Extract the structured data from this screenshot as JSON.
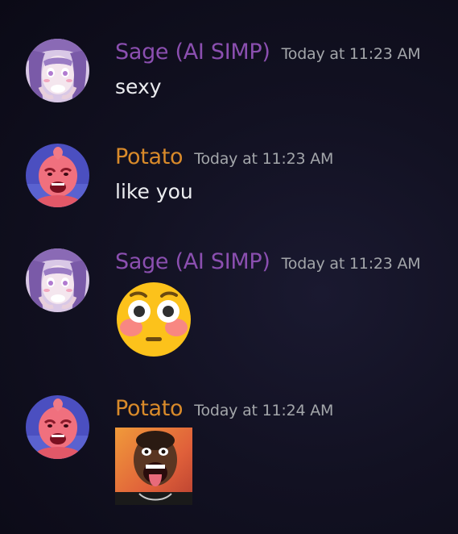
{
  "messages": [
    {
      "author": "Sage (AI SIMP)",
      "timestamp": "Today at 11:23 AM",
      "text": "sexy",
      "avatar_icon": "anime-girl-avatar",
      "author_color": "#8b4fb0"
    },
    {
      "author": "Potato",
      "timestamp": "Today at 11:23 AM",
      "text": "like you",
      "avatar_icon": "pink-majin-avatar",
      "author_color": "#d98a2a"
    },
    {
      "author": "Sage (AI SIMP)",
      "timestamp": "Today at 11:23 AM",
      "emoji": "flushed-face-emoji",
      "avatar_icon": "anime-girl-avatar",
      "author_color": "#8b4fb0"
    },
    {
      "author": "Potato",
      "timestamp": "Today at 11:24 AM",
      "attachment": "shouting-man-image",
      "avatar_icon": "pink-majin-avatar",
      "author_color": "#d98a2a"
    }
  ]
}
